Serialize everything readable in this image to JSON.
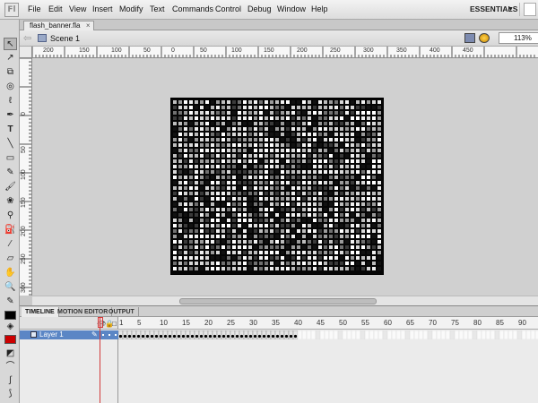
{
  "menubar": {
    "logo": "Fl",
    "items": [
      "File",
      "Edit",
      "View",
      "Insert",
      "Modify",
      "Text",
      "Commands",
      "Control",
      "Debug",
      "Window",
      "Help"
    ],
    "workspace": "ESSENTIALS"
  },
  "document": {
    "tab_label": "flash_banner.fla",
    "tab_close": "×",
    "scene_label": "Scene 1",
    "zoom": "113%"
  },
  "rulers": {
    "horizontal": [
      "200",
      "150",
      "100",
      "50",
      "0",
      "50",
      "100",
      "150",
      "200",
      "250",
      "300",
      "350",
      "400",
      "450"
    ],
    "vertical": [
      "0",
      "50",
      "100",
      "150",
      "200",
      "250",
      "300"
    ]
  },
  "timeline": {
    "tabs": [
      "TIMELINE",
      "MOTION EDITOR",
      "OUTPUT"
    ],
    "frame_numbers": [
      "1",
      "5",
      "10",
      "15",
      "20",
      "25",
      "30",
      "35",
      "40",
      "45",
      "50",
      "55",
      "60",
      "65",
      "70",
      "75",
      "80",
      "85",
      "90"
    ],
    "layer_name": "Layer 1",
    "keyframe_count": 40
  },
  "colors": {
    "stroke_color": "#000000",
    "fill_color": "#cc0000",
    "layer_highlight": "#5b86c5"
  }
}
